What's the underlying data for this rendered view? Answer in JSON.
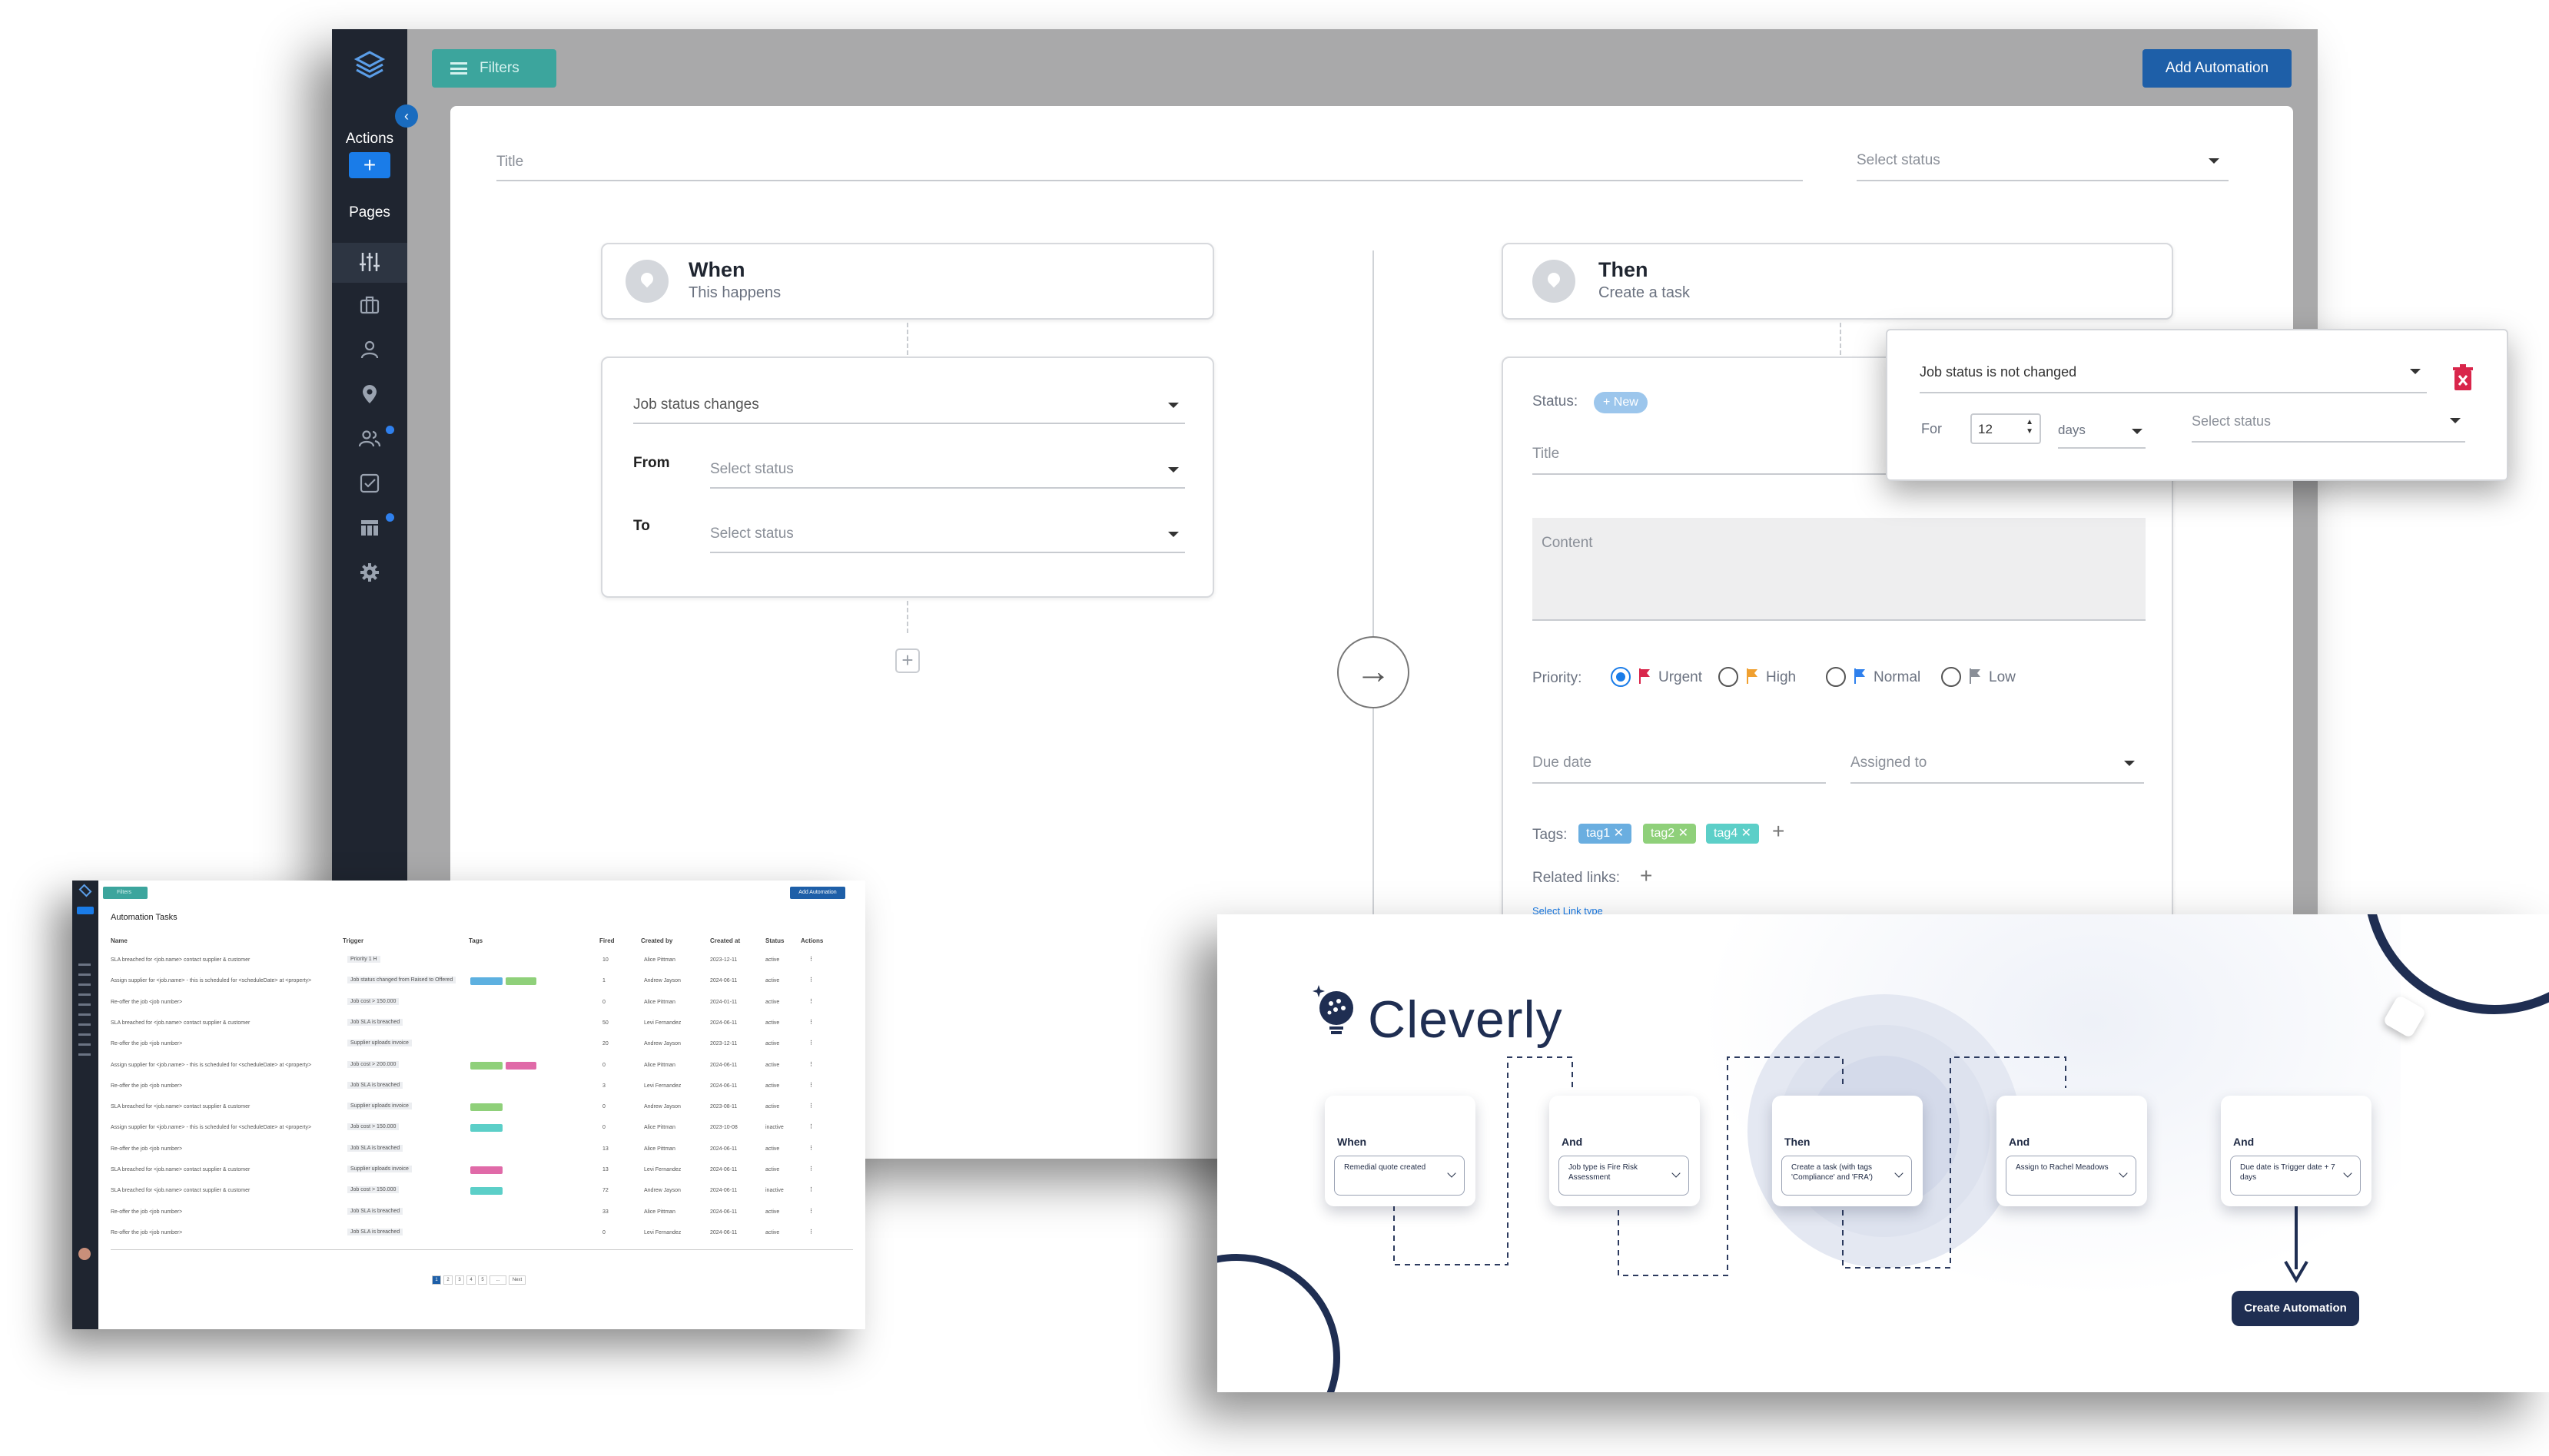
{
  "main": {
    "sidebar": {
      "actions_label": "Actions",
      "add_label": "+",
      "pages_label": "Pages",
      "collapse_glyph": "‹",
      "icons": [
        "sliders-icon",
        "briefcase-icon",
        "user-icon",
        "location-pin-icon",
        "users-icon",
        "checkbox-icon",
        "table-icon",
        "gear-icon"
      ]
    },
    "toolbar": {
      "filters_label": "Filters",
      "add_automation_label": "Add Automation"
    },
    "form": {
      "title_placeholder": "Title",
      "status_placeholder": "Select status"
    },
    "when": {
      "title": "When",
      "subtitle": "This happens",
      "trigger_value": "Job status changes",
      "from_label": "From",
      "from_placeholder": "Select status",
      "to_label": "To",
      "to_placeholder": "Select status",
      "add_glyph": "+"
    },
    "then": {
      "title": "Then",
      "subtitle": "Create a task",
      "status_label": "Status:",
      "status_badge": "+ New",
      "title_placeholder": "Title",
      "content_placeholder": "Content",
      "priority_label": "Priority:",
      "priorities": [
        {
          "label": "Urgent",
          "flag_color": "#d9264b",
          "selected": true
        },
        {
          "label": "High",
          "flag_color": "#f0a030",
          "selected": false
        },
        {
          "label": "Normal",
          "flag_color": "#2f80ed",
          "selected": false
        },
        {
          "label": "Low",
          "flag_color": "#8a8f98",
          "selected": false
        }
      ],
      "due_date_placeholder": "Due date",
      "assigned_placeholder": "Assigned to",
      "tags_label": "Tags:",
      "tags": [
        {
          "label": "tag1",
          "color": "#6aaee0"
        },
        {
          "label": "tag2",
          "color": "#8fd07a"
        },
        {
          "label": "tag4",
          "color": "#5ccfc8"
        }
      ],
      "related_links_label": "Related links:",
      "select_link_type": "Select Link type"
    },
    "arrow_glyph": "→"
  },
  "popup": {
    "condition_value": "Job status is not changed",
    "for_label": "For",
    "for_number": "12",
    "unit_value": "days",
    "status_placeholder": "Select status",
    "delete_icon": "trash-icon"
  },
  "tasks": {
    "filters_label": "Filters",
    "add_label": "Add Automation",
    "title": "Automation Tasks",
    "columns": [
      "Name",
      "Trigger",
      "Tags",
      "Fired",
      "Created by",
      "Created at",
      "Status",
      "Actions"
    ],
    "rows": [
      {
        "name": "SLA breached for <job.name> contact supplier & customer",
        "trigger": "Priority 1 H",
        "tags": [],
        "fired": "10",
        "by": "Alice Pittman",
        "at": "2023-12-11",
        "status": "active"
      },
      {
        "name": "Assign supplier for <job.name> - this is scheduled for <scheduleDate> at <property>",
        "trigger": "Job status changed from Raised to Offered",
        "tags": [
          "#5db0e0",
          "#8fd07a"
        ],
        "fired": "1",
        "by": "Andrew Jayson",
        "at": "2024-06-11",
        "status": "active"
      },
      {
        "name": "Re-offer the job <job number>",
        "trigger": "Job cost > 150.000",
        "tags": [],
        "fired": "0",
        "by": "Alice Pittman",
        "at": "2024-01-11",
        "status": "active"
      },
      {
        "name": "SLA breached for <job.name> contact supplier & customer",
        "trigger": "Job SLA is breached",
        "tags": [],
        "fired": "50",
        "by": "Levi Fernandez",
        "at": "2024-06-11",
        "status": "active"
      },
      {
        "name": "Re-offer the job <job number>",
        "trigger": "Supplier uploads invoice",
        "tags": [],
        "fired": "20",
        "by": "Andrew Jayson",
        "at": "2023-12-11",
        "status": "active"
      },
      {
        "name": "Assign supplier for <job.name> - this is scheduled for <scheduleDate> at <property>",
        "trigger": "Job cost > 200.000",
        "tags": [
          "#8fd07a",
          "#e06aa8"
        ],
        "fired": "0",
        "by": "Alice Pittman",
        "at": "2024-06-11",
        "status": "active"
      },
      {
        "name": "Re-offer the job <job number>",
        "trigger": "Job SLA is breached",
        "tags": [],
        "fired": "3",
        "by": "Levi Fernandez",
        "at": "2024-06-11",
        "status": "active"
      },
      {
        "name": "SLA breached for <job.name> contact supplier & customer",
        "trigger": "Supplier uploads invoice",
        "tags": [
          "#8fd07a"
        ],
        "fired": "0",
        "by": "Andrew Jayson",
        "at": "2023-08-11",
        "status": "active"
      },
      {
        "name": "Assign supplier for <job.name> - this is scheduled for <scheduleDate> at <property>",
        "trigger": "Job cost > 150.000",
        "tags": [
          "#5ccfc8"
        ],
        "fired": "0",
        "by": "Alice Pittman",
        "at": "2023-10-08",
        "status": "inactive"
      },
      {
        "name": "Re-offer the job <job number>",
        "trigger": "Job SLA is breached",
        "tags": [],
        "fired": "13",
        "by": "Alice Pittman",
        "at": "2024-06-11",
        "status": "active"
      },
      {
        "name": "SLA breached for <job.name> contact supplier & customer",
        "trigger": "Supplier uploads invoice",
        "tags": [
          "#e06aa8"
        ],
        "fired": "13",
        "by": "Levi Fernandez",
        "at": "2024-06-11",
        "status": "active"
      },
      {
        "name": "SLA breached for <job.name> contact supplier & customer",
        "trigger": "Job cost > 150.000",
        "tags": [
          "#5ccfc8"
        ],
        "fired": "72",
        "by": "Andrew Jayson",
        "at": "2024-06-11",
        "status": "inactive"
      },
      {
        "name": "Re-offer the job <job number>",
        "trigger": "Job SLA is breached",
        "tags": [],
        "fired": "33",
        "by": "Alice Pittman",
        "at": "2024-06-11",
        "status": "active"
      },
      {
        "name": "Re-offer the job <job number>",
        "trigger": "Job SLA is breached",
        "tags": [],
        "fired": "0",
        "by": "Levi Fernandez",
        "at": "2024-06-11",
        "status": "active"
      }
    ],
    "pagination": [
      "1",
      "2",
      "3",
      "4",
      "5",
      "...",
      "Next"
    ]
  },
  "cleverly": {
    "logo_text": "Cleverly",
    "cards": [
      {
        "title": "When",
        "value": "Remedial quote created"
      },
      {
        "title": "And",
        "value": "Job type is Fire Risk Assessment"
      },
      {
        "title": "Then",
        "value": "Create a task (with tags 'Compliance' and 'FRA')"
      },
      {
        "title": "And",
        "value": "Assign to Rachel Meadows"
      },
      {
        "title": "And",
        "value": "Due date is Trigger date + 7 days"
      }
    ],
    "cta_label": "Create Automation",
    "accent_color": "#1f2e52"
  }
}
